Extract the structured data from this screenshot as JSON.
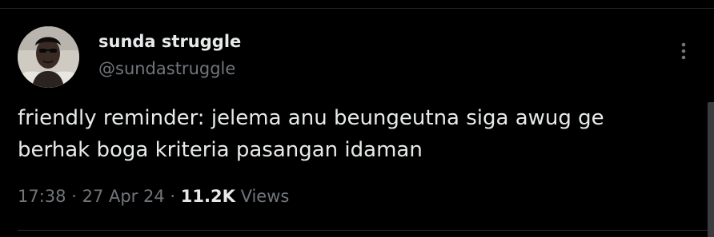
{
  "tweet": {
    "author": {
      "display_name": "sunda struggle",
      "handle": "@sundastruggle"
    },
    "text_lines": [
      "friendly reminder: jelema anu beungeutna siga awug ge",
      "berhak boga kriteria pasangan idaman"
    ],
    "time": "17:38",
    "separator": "·",
    "date": "27 Apr 24",
    "views_count": "11.2K",
    "views_label": "Views",
    "more_icon": "more-vertical-icon"
  },
  "colors": {
    "background": "#000000",
    "primary_text": "#e7e9ea",
    "secondary_text": "#71767b",
    "divider": "#2f3336"
  }
}
